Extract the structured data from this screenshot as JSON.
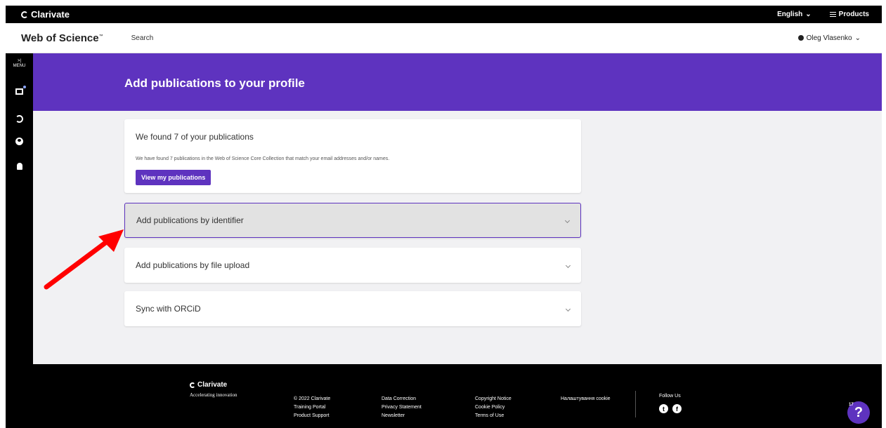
{
  "topbar": {
    "brand": "Clarivate",
    "language": "English",
    "products": "Products"
  },
  "header": {
    "app_name": "Web of Science",
    "app_tm": "™",
    "search": "Search",
    "user": "Oleg Vlasenko"
  },
  "rail": {
    "menu_label": "MENU"
  },
  "banner": {
    "title": "Add publications to your profile"
  },
  "found": {
    "title": "We found 7 of your publications",
    "text": "We have found 7 publications in the Web of Science Core Collection that match your email addresses and/or names.",
    "button": "View my publications"
  },
  "accordions": [
    {
      "label": "Add publications by identifier"
    },
    {
      "label": "Add publications by file upload"
    },
    {
      "label": "Sync with ORCiD"
    }
  ],
  "footer": {
    "brand": "Clarivate",
    "tagline": "Accelerating innovation",
    "col1": [
      "© 2022 Clarivate",
      "Training Portal",
      "Product Support"
    ],
    "col2": [
      "Data Correction",
      "Privacy Statement",
      "Newsletter"
    ],
    "col3": [
      "Copyright Notice",
      "Cookie Policy",
      "Terms of Use"
    ],
    "col4": [
      "Налаштування cookie"
    ],
    "follow": "Follow Us"
  },
  "help": {
    "label": "?",
    "badge": "17"
  },
  "colors": {
    "accent": "#5e33bf",
    "arrow": "#ff0000"
  }
}
